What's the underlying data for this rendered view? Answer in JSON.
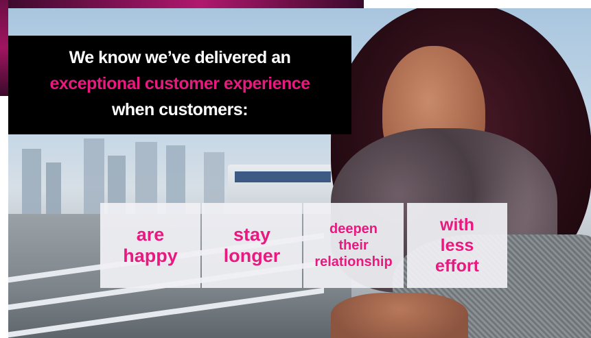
{
  "headline": {
    "line1": "We know we’ve delivered an",
    "line2": "exceptional customer experience",
    "line3": "when customers:"
  },
  "cards": [
    {
      "lines": [
        "are",
        "happy"
      ]
    },
    {
      "lines": [
        "stay",
        "longer"
      ]
    },
    {
      "lines": [
        "deepen",
        "their",
        "relationship"
      ]
    },
    {
      "lines": [
        "with",
        "less",
        "effort"
      ]
    }
  ],
  "colors": {
    "accent": "#e8197f",
    "headline_bg": "#000000",
    "headline_text": "#ffffff",
    "card_bg": "#f0f0f4"
  }
}
